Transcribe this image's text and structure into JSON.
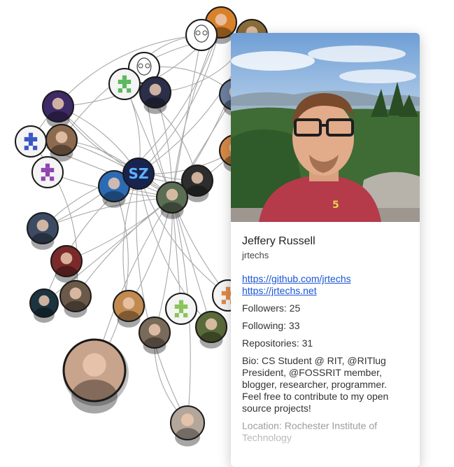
{
  "profile": {
    "name": "Jeffery Russell",
    "login": "jrtechs",
    "github_url": "https://github.com/jrtechs",
    "website_url": "https://jrtechs.net",
    "followers": "Followers: 25",
    "following": "Following: 33",
    "repositories": "Repositories: 31",
    "bio": "Bio: CS Student @ RIT, @RITlug President, @FOSSRIT member, blogger, researcher, programmer. Feel free to contribute to my open source projects!",
    "location": "Location: Rochester Institute of Technology"
  },
  "graph": {
    "center_badge_text": "SZ",
    "nodes": [
      {
        "name": "node-top-artist",
        "kind": "photo",
        "color": "#d9812a"
      },
      {
        "name": "node-sketch-avatar",
        "kind": "sketch",
        "color": "#ffffff"
      },
      {
        "name": "node-partial-top-right",
        "kind": "photo",
        "color": "#8a6d3b"
      },
      {
        "name": "node-sketch-glasses",
        "kind": "sketch",
        "color": "#ffffff"
      },
      {
        "name": "node-green-identicon",
        "kind": "identicon",
        "color": "#5cb85c"
      },
      {
        "name": "node-dark-stage",
        "kind": "photo",
        "color": "#2b2f4a"
      },
      {
        "name": "node-purple-art",
        "kind": "photo",
        "color": "#3d2a66"
      },
      {
        "name": "node-blue-identicon",
        "kind": "identicon",
        "color": "#3a55c4"
      },
      {
        "name": "node-glasses-guy",
        "kind": "photo",
        "color": "#8b6a4f"
      },
      {
        "name": "node-purple-identicon",
        "kind": "identicon",
        "color": "#9045b0"
      },
      {
        "name": "node-nyan-cat",
        "kind": "photo",
        "color": "#2c6bb4"
      },
      {
        "name": "node-sz-badge",
        "kind": "badge",
        "color": "#18244f"
      },
      {
        "name": "node-hat-logo",
        "kind": "photo",
        "color": "#2d2d2d"
      },
      {
        "name": "node-center-user",
        "kind": "photo",
        "color": "#5b6e53"
      },
      {
        "name": "node-suit-guy",
        "kind": "photo",
        "color": "#3c4b63"
      },
      {
        "name": "node-red-photo",
        "kind": "photo",
        "color": "#7a2a2a"
      },
      {
        "name": "node-dark-teal",
        "kind": "photo",
        "color": "#1b3440"
      },
      {
        "name": "node-smiling-guy",
        "kind": "photo",
        "color": "#6b5a4a"
      },
      {
        "name": "node-white-shirt",
        "kind": "photo",
        "color": "#c28a50"
      },
      {
        "name": "node-green-identicon-2",
        "kind": "identicon",
        "color": "#8bc45a"
      },
      {
        "name": "node-orange-identicon",
        "kind": "identicon",
        "color": "#e08a48"
      },
      {
        "name": "node-plaid-guy",
        "kind": "photo",
        "color": "#7a6a5a"
      },
      {
        "name": "node-sunglasses",
        "kind": "photo",
        "color": "#5a6a3a"
      },
      {
        "name": "node-woman-large",
        "kind": "photo",
        "color": "#c9a48c"
      },
      {
        "name": "node-woman-bottom",
        "kind": "photo",
        "color": "#b3a69a"
      },
      {
        "name": "node-partial-right-1",
        "kind": "photo",
        "color": "#6b7fa0"
      },
      {
        "name": "node-partial-right-2",
        "kind": "photo",
        "color": "#d48a48"
      }
    ]
  }
}
